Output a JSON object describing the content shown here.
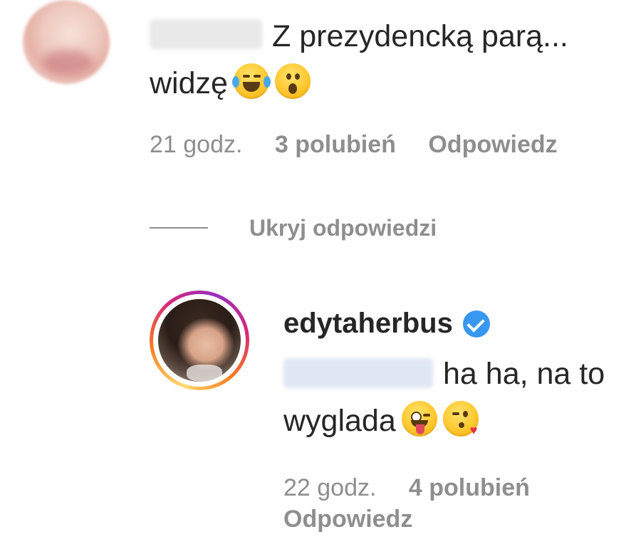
{
  "comment": {
    "text_line1": "Z prezydencką parą...",
    "text_line2": "widzę",
    "emojis": [
      "face-with-tears-of-joy",
      "face-with-open-mouth"
    ],
    "time": "21 godz.",
    "likes": "3 polubień",
    "reply_label": "Odpowiedz"
  },
  "thread": {
    "hide_replies_label": "Ukryj odpowiedzi"
  },
  "reply": {
    "username": "edytaherbus",
    "verified": true,
    "text_line1": "ha ha, na to",
    "text_line2": "wyglada",
    "emojis": [
      "winking-face-with-tongue",
      "face-blowing-kiss"
    ],
    "time": "22 godz.",
    "likes": "4 polubień",
    "reply_label": "Odpowiedz"
  },
  "colors": {
    "text": "#262626",
    "secondary": "#8e8e8e",
    "verified_blue": "#3897f0"
  }
}
